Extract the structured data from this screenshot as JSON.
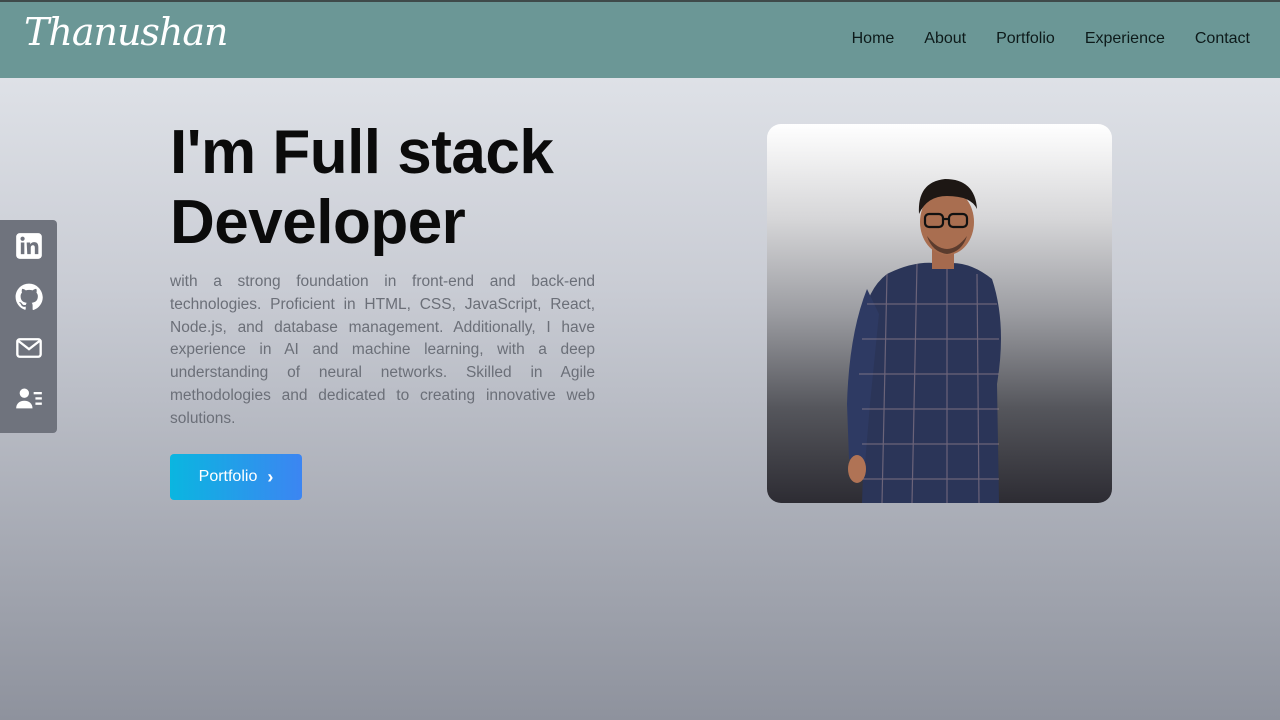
{
  "brand": {
    "logo": "Thanushan"
  },
  "nav": {
    "items": [
      {
        "label": "Home"
      },
      {
        "label": "About"
      },
      {
        "label": "Portfolio"
      },
      {
        "label": "Experience"
      },
      {
        "label": "Contact"
      }
    ]
  },
  "social": {
    "items": [
      {
        "icon": "linkedin-icon"
      },
      {
        "icon": "github-icon"
      },
      {
        "icon": "mail-icon"
      },
      {
        "icon": "contact-card-icon"
      }
    ]
  },
  "hero": {
    "title_line1": "I'm Full stack",
    "title_line2": "Developer",
    "description": "with a strong foundation in front-end and back-end technologies. Proficient in HTML, CSS, JavaScript, React, Node.js, and database management. Additionally, I have experience in AI and machine learning, with a deep understanding of neural networks. Skilled in Agile methodologies and dedicated to creating innovative web solutions.",
    "button_label": "Portfolio",
    "button_icon": "chevron-right-icon"
  },
  "colors": {
    "nav_bg": "#6b9796",
    "button_start": "#0ab6e0",
    "button_end": "#3c85f2",
    "sidebar_bg": "#6f737d"
  }
}
